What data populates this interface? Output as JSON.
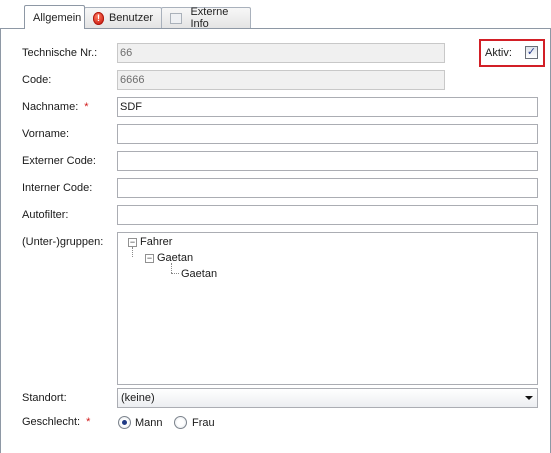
{
  "tabs": [
    {
      "label": "Allgemein",
      "icon": null,
      "active": true
    },
    {
      "label": "Benutzer",
      "icon": "error-icon",
      "active": false
    },
    {
      "label": "Externe Info",
      "icon": "info-icon",
      "active": false
    }
  ],
  "form": {
    "technische_nr": {
      "label": "Technische Nr.:",
      "value": "66"
    },
    "code": {
      "label": "Code:",
      "value": "6666"
    },
    "nachname": {
      "label": "Nachname:",
      "required_marker": "*",
      "value": "SDF"
    },
    "vorname": {
      "label": "Vorname:",
      "value": ""
    },
    "externer_code": {
      "label": "Externer Code:",
      "value": ""
    },
    "interner_code": {
      "label": "Interner Code:",
      "value": ""
    },
    "autofilter": {
      "label": "Autofilter:",
      "value": ""
    },
    "untergruppen": {
      "label": "(Unter-)gruppen:",
      "tree": [
        {
          "label": "Fahrer",
          "expander": "−"
        },
        {
          "label": "Gaetan",
          "expander": "−"
        },
        {
          "label": "Gaetan"
        }
      ]
    },
    "standort": {
      "label": "Standort:",
      "value": "(keine)"
    },
    "geschlecht": {
      "label": "Geschlecht:",
      "required_marker": "*",
      "options": [
        {
          "label": "Mann",
          "selected": true
        },
        {
          "label": "Frau",
          "selected": false
        }
      ]
    },
    "aktiv": {
      "label": "Aktiv:",
      "checked": true,
      "highlight_color": "#d21f26"
    }
  }
}
